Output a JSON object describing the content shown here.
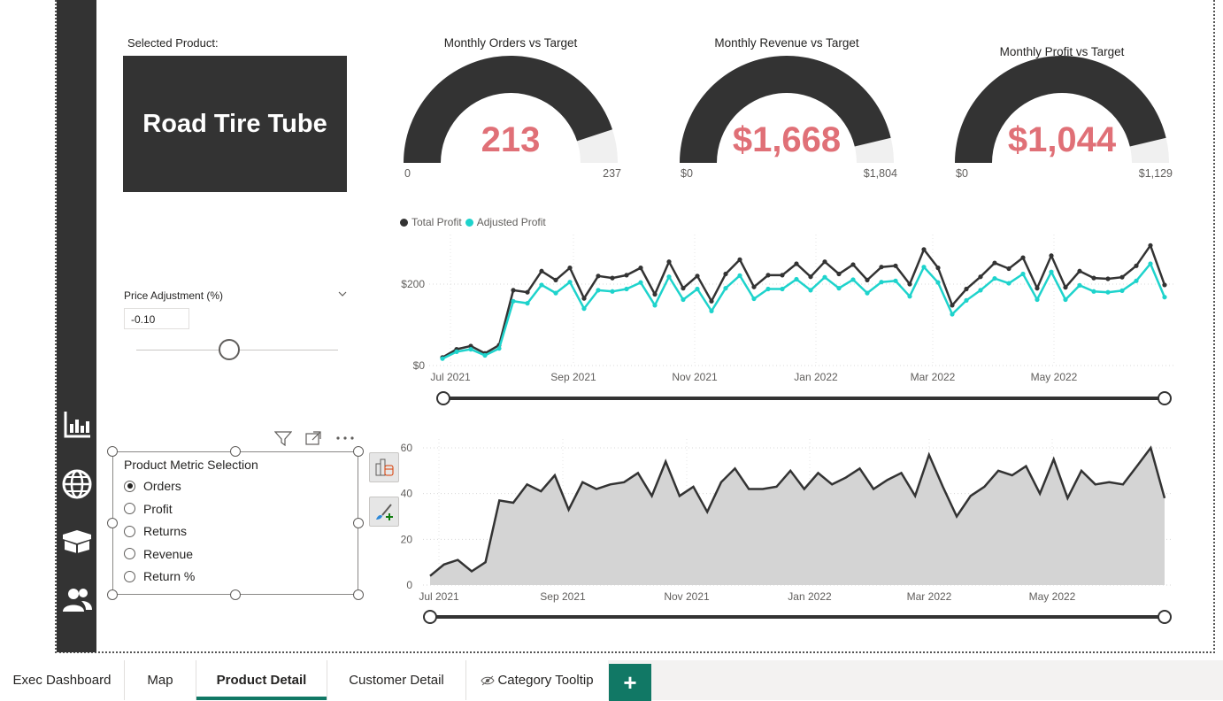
{
  "selected_product": {
    "label": "Selected Product:",
    "value": "Road Tire Tube"
  },
  "gauges": [
    {
      "title": "Monthly Orders vs Target",
      "value": "213",
      "min": "0",
      "max": "237",
      "fraction": 0.899
    },
    {
      "title": "Monthly Revenue vs Target",
      "value": "$1,668",
      "min": "$0",
      "max": "$1,804",
      "fraction": 0.925
    },
    {
      "title": "Monthly Profit vs Target",
      "value": "$1,044",
      "min": "$0",
      "max": "$1,129",
      "fraction": 0.925
    }
  ],
  "price_adjustment": {
    "label": "Price Adjustment (%)",
    "value": "-0.10",
    "slider_fraction": 0.46
  },
  "metric_selection": {
    "title": "Product Metric Selection",
    "options": [
      "Orders",
      "Profit",
      "Returns",
      "Revenue",
      "Return %"
    ],
    "selected": "Orders"
  },
  "tabs": [
    {
      "label": "Exec Dashboard",
      "active": false
    },
    {
      "label": "Map",
      "active": false
    },
    {
      "label": "Product Detail",
      "active": true
    },
    {
      "label": "Customer Detail",
      "active": false
    },
    {
      "label": "Category Tooltip",
      "active": false,
      "hidden_icon": "eye-off-icon"
    }
  ],
  "add_tab_label": "+",
  "colors": {
    "accent": "#117865",
    "kpi_value": "#E07077",
    "dark": "#333333",
    "teal": "#1ED3CC",
    "gauge_track": "#F0F0F0"
  },
  "chart_data": [
    {
      "type": "line",
      "legend_position": "top-left",
      "x_tick_labels": [
        "Jul 2021",
        "Sep 2021",
        "Nov 2021",
        "Jan 2022",
        "Mar 2022",
        "May 2022"
      ],
      "y_tick_labels": [
        "$0",
        "$200"
      ],
      "ylim": [
        0,
        300
      ],
      "series": [
        {
          "name": "Total Profit",
          "color": "#333333",
          "values": [
            20,
            40,
            48,
            30,
            50,
            185,
            180,
            232,
            210,
            240,
            165,
            220,
            215,
            222,
            240,
            175,
            255,
            190,
            220,
            158,
            225,
            260,
            193,
            222,
            222,
            250,
            218,
            255,
            225,
            248,
            210,
            242,
            245,
            200,
            285,
            240,
            148,
            188,
            218,
            252,
            238,
            265,
            190,
            270,
            192,
            232,
            215,
            213,
            217,
            245,
            295,
            198
          ]
        },
        {
          "name": "Adjusted Profit",
          "color": "#1ED3CC",
          "values": [
            17,
            34,
            40,
            25,
            42,
            158,
            153,
            198,
            178,
            205,
            140,
            185,
            182,
            188,
            204,
            148,
            218,
            162,
            188,
            134,
            190,
            221,
            164,
            188,
            188,
            212,
            185,
            217,
            190,
            211,
            178,
            205,
            208,
            170,
            242,
            204,
            126,
            160,
            185,
            214,
            202,
            225,
            162,
            230,
            162,
            197,
            182,
            180,
            184,
            208,
            250,
            168
          ]
        }
      ]
    },
    {
      "type": "area",
      "x_tick_labels": [
        "Jul 2021",
        "Sep 2021",
        "Nov 2021",
        "Jan 2022",
        "Mar 2022",
        "May 2022"
      ],
      "y_tick_labels": [
        "0",
        "20",
        "40",
        "60"
      ],
      "ylim": [
        0,
        60
      ],
      "series": [
        {
          "name": "Orders",
          "color": "#333333",
          "values": [
            4,
            9,
            11,
            6,
            10,
            37,
            36,
            44,
            41,
            48,
            33,
            45,
            42,
            44,
            45,
            49,
            39,
            54,
            39,
            43,
            32,
            45,
            51,
            42,
            42,
            43,
            50,
            42,
            49,
            44,
            47,
            51,
            42,
            46,
            49,
            39,
            57,
            43,
            30,
            39,
            43,
            50,
            48,
            52,
            40,
            55,
            38,
            50,
            44,
            45,
            44,
            52,
            60,
            38
          ]
        }
      ]
    }
  ]
}
